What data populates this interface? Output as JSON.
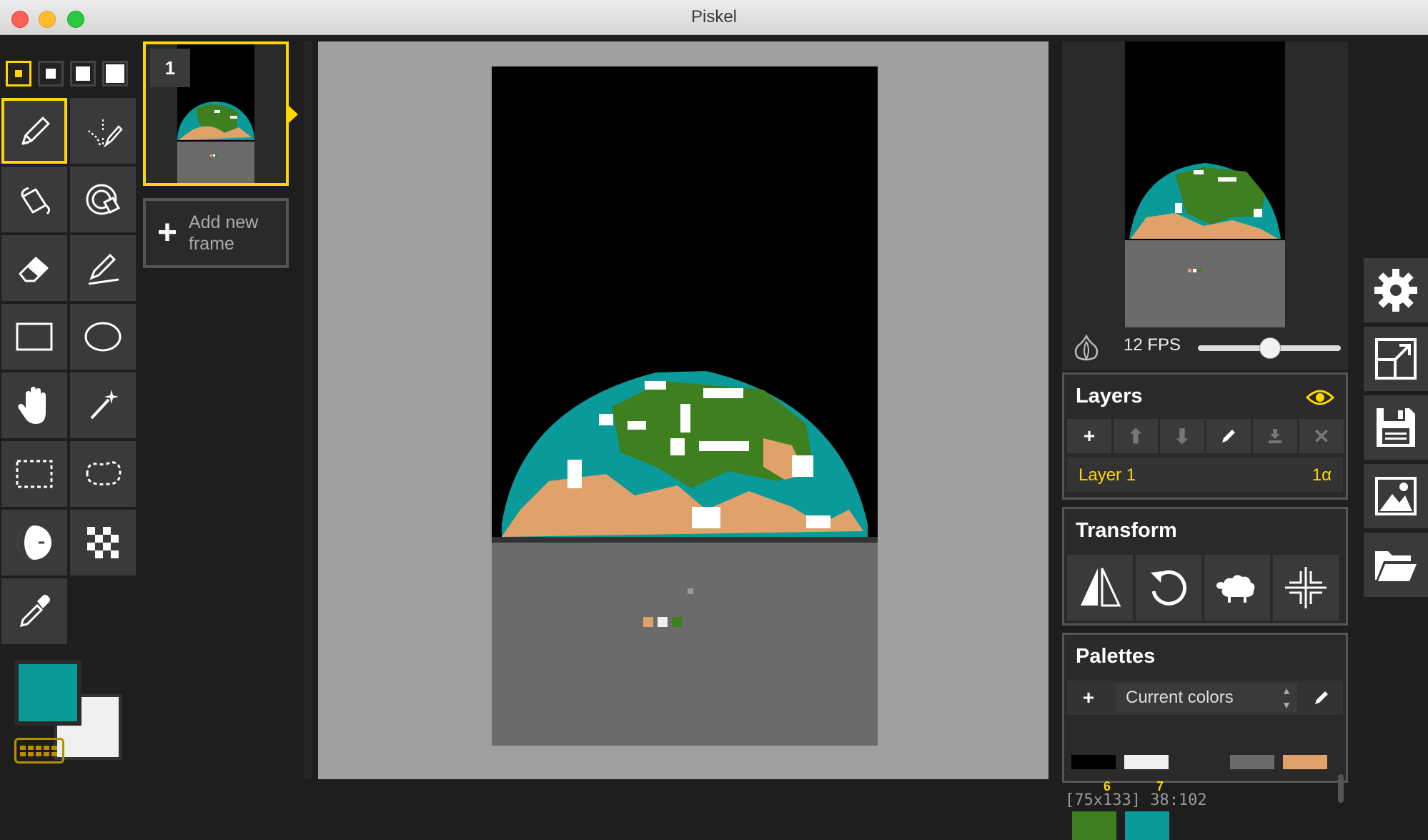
{
  "window": {
    "title": "Piskel"
  },
  "frames": {
    "frame_number": "1",
    "add_label_line1": "Add new",
    "add_label_line2": "frame"
  },
  "colors": {
    "primary": "#0b9a9a",
    "secondary": "#f0f0f0",
    "accent": "#ffd700"
  },
  "preview": {
    "fps_label": "12 FPS",
    "fps_value": 12
  },
  "layers": {
    "title": "Layers",
    "items": [
      {
        "name": "Layer 1",
        "alpha": "1α"
      }
    ]
  },
  "transform": {
    "title": "Transform"
  },
  "palettes": {
    "title": "Palettes",
    "selected": "Current colors",
    "swatches": [
      "#000000",
      "#f0f0f0",
      "#2b2b2b",
      "#6b6b6b",
      "#e0a26a",
      "#3e7f1f",
      "#0b9a9a"
    ],
    "swatch_numbers": [
      "6",
      "7"
    ]
  },
  "status": {
    "cursor": "[75x133] 38:102"
  },
  "tools": [
    "pen-tool",
    "vertical-mirror-pen-tool",
    "paint-bucket-tool",
    "paint-same-color-tool",
    "eraser-tool",
    "stroke-tool",
    "rectangle-tool",
    "circle-tool",
    "move-tool",
    "shape-selection-tool",
    "rectangle-selection-tool",
    "lasso-selection-tool",
    "lighten-tool",
    "dithering-tool",
    "color-picker-tool"
  ]
}
